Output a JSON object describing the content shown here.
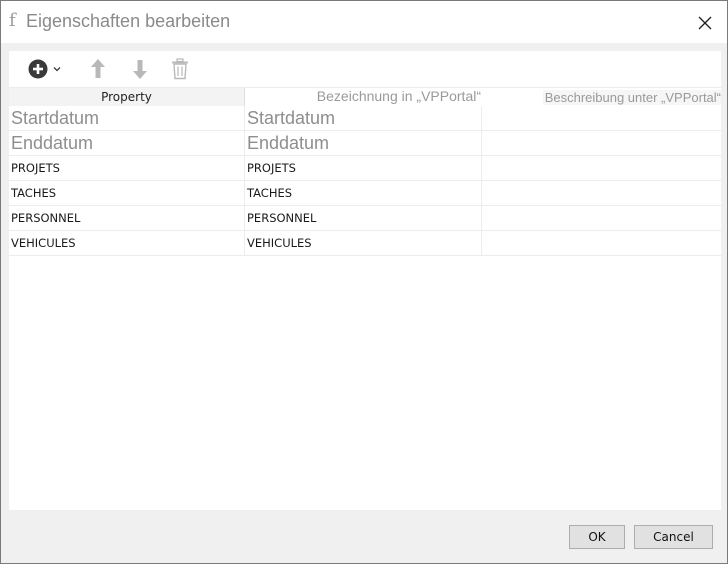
{
  "window": {
    "icon_glyph": "f",
    "title": "Eigenschaften bearbeiten"
  },
  "toolbar": {
    "add_icon": "plus-circle-icon",
    "dropdown_icon": "chevron-down-icon",
    "up_icon": "arrow-up-icon",
    "down_icon": "arrow-down-icon",
    "delete_icon": "trash-icon"
  },
  "table": {
    "columns": [
      "Property",
      "Bezeichnung in „VPPortal“",
      "Beschreibung unter „VPPortal“"
    ],
    "rows": [
      {
        "property": "Startdatum",
        "label": "Startdatum",
        "description": ""
      },
      {
        "property": "Enddatum",
        "label": "Enddatum",
        "description": ""
      },
      {
        "property": "PROJETS",
        "label": "PROJETS",
        "description": ""
      },
      {
        "property": "TACHES",
        "label": "TACHES",
        "description": ""
      },
      {
        "property": "PERSONNEL",
        "label": "PERSONNEL",
        "description": ""
      },
      {
        "property": "VEHICULES",
        "label": "VEHICULES",
        "description": ""
      }
    ]
  },
  "buttons": {
    "ok": "OK",
    "cancel": "Cancel"
  },
  "colors": {
    "icon_active": "#3a3a3a",
    "icon_disabled": "#b8b8b8",
    "placeholder_text": "#8e8e8e"
  }
}
